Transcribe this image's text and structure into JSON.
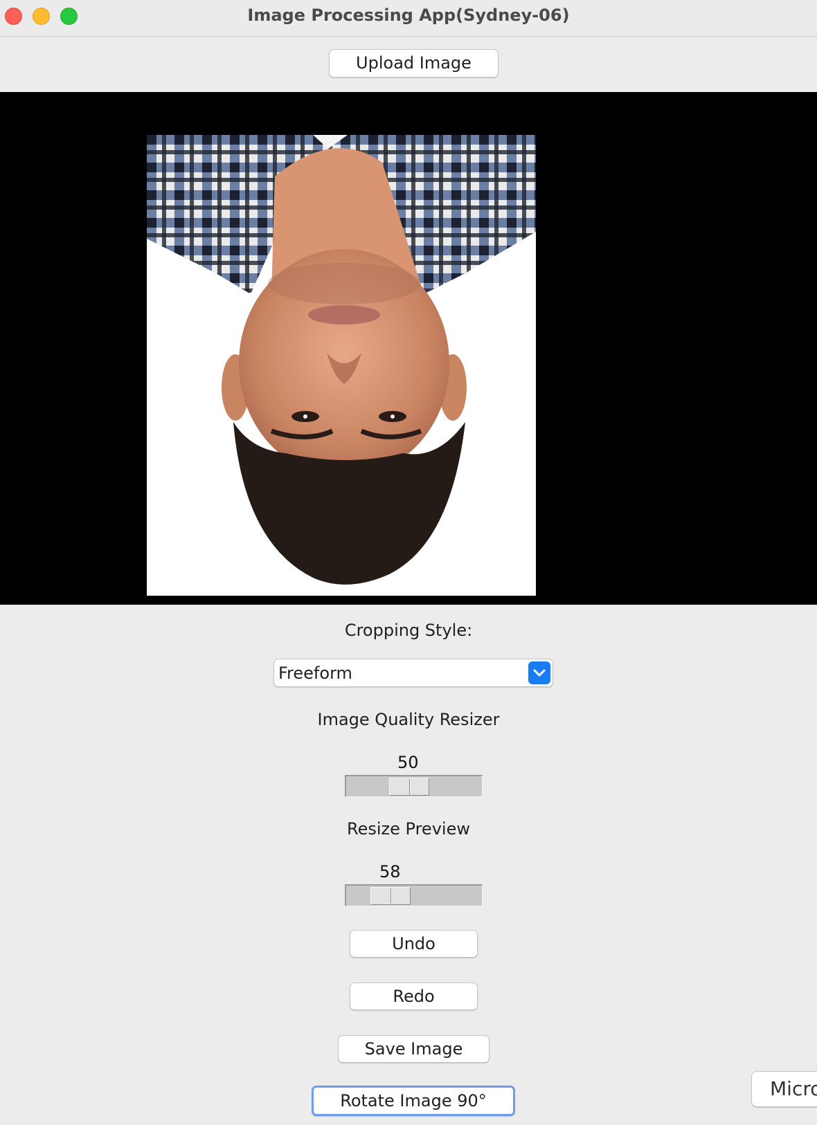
{
  "window": {
    "title": "Image Processing App(Sydney-06)"
  },
  "toolbar": {
    "upload_label": "Upload Image"
  },
  "canvas": {
    "background_color": "#000000",
    "image_content": "upside-down portrait photo of a man in a plaid shirt on white background"
  },
  "cropping": {
    "label": "Cropping Style:",
    "selected": "Freeform"
  },
  "quality": {
    "label": "Image Quality Resizer",
    "value": "50"
  },
  "resize": {
    "label": "Resize Preview",
    "value": "58"
  },
  "buttons": {
    "undo": "Undo",
    "redo": "Redo",
    "save": "Save Image",
    "rotate": "Rotate Image 90°"
  },
  "background_window": {
    "partial_label": "Micro"
  },
  "colors": {
    "accent": "#1a7cf5",
    "focus_ring": "#6a9ee8"
  }
}
